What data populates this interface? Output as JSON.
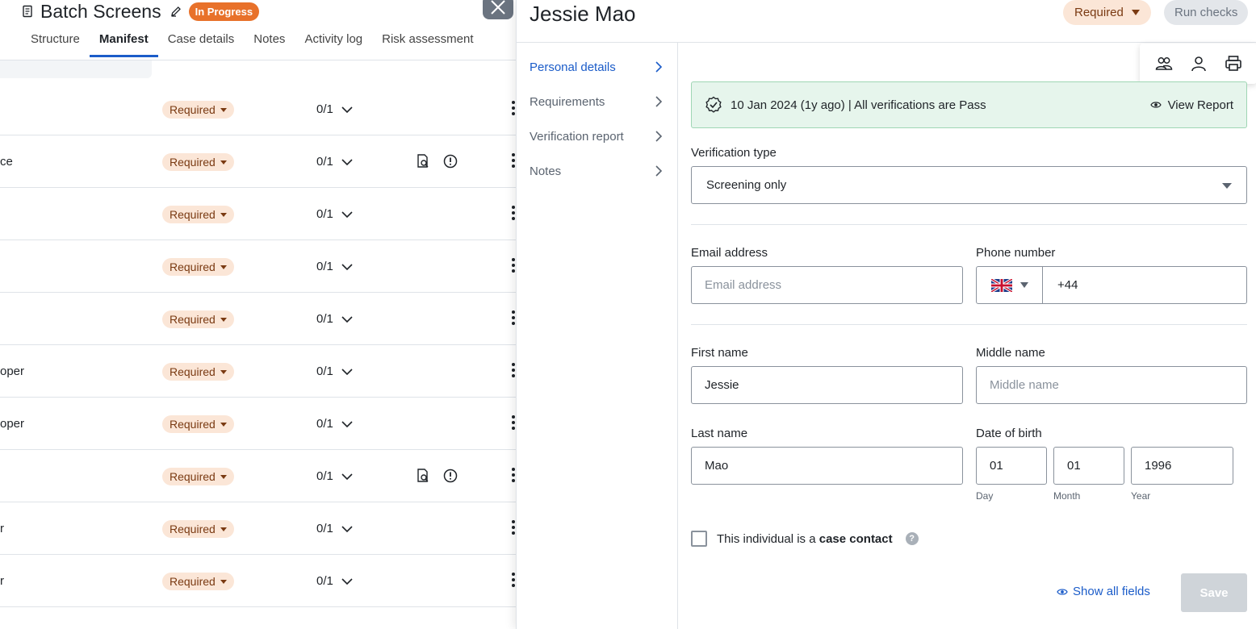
{
  "background": {
    "title": "Batch Screens",
    "status_badge": "In Progress",
    "tabs": [
      {
        "label": "Structure"
      },
      {
        "label": "Manifest"
      },
      {
        "label": "Case details"
      },
      {
        "label": "Notes"
      },
      {
        "label": "Activity log"
      },
      {
        "label": "Risk assessment"
      }
    ],
    "rows": [
      {
        "text": "",
        "status": "Required",
        "count": "0/1"
      },
      {
        "text": "ce",
        "status": "Required",
        "count": "0/1"
      },
      {
        "text": "",
        "status": "Required",
        "count": "0/1"
      },
      {
        "text": "",
        "status": "Required",
        "count": "0/1"
      },
      {
        "text": "",
        "status": "Required",
        "count": "0/1"
      },
      {
        "text": "oper",
        "status": "Required",
        "count": "0/1"
      },
      {
        "text": "oper",
        "status": "Required",
        "count": "0/1"
      },
      {
        "text": "",
        "status": "Required",
        "count": "0/1"
      },
      {
        "text": "r",
        "status": "Required",
        "count": "0/1"
      },
      {
        "text": "r",
        "status": "Required",
        "count": "0/1"
      }
    ]
  },
  "drawer": {
    "name": "Jessie Mao",
    "status_button": "Required",
    "run_checks": "Run checks",
    "nav": [
      {
        "label": "Personal details"
      },
      {
        "label": "Requirements"
      },
      {
        "label": "Verification report"
      },
      {
        "label": "Notes"
      }
    ],
    "toolbar_icons": [
      "people-icon",
      "person-icon",
      "printer-icon"
    ],
    "verification": {
      "summary": "10 Jan 2024 (1y ago)  |  All verifications are Pass",
      "view_report": "View Report"
    },
    "form": {
      "verification_type_label": "Verification type",
      "verification_type_value": "Screening only",
      "email_label": "Email address",
      "email_placeholder": "Email address",
      "phone_label": "Phone number",
      "phone_code": "+44",
      "first_name_label": "First name",
      "first_name_value": "Jessie",
      "middle_name_label": "Middle name",
      "middle_name_placeholder": "Middle name",
      "last_name_label": "Last name",
      "last_name_value": "Mao",
      "dob_label": "Date of birth",
      "dob_day": "01",
      "dob_month": "01",
      "dob_year": "1996",
      "dob_day_label": "Day",
      "dob_month_label": "Month",
      "dob_year_label": "Year",
      "case_contact_prefix": "This individual is a ",
      "case_contact_bold": "case contact",
      "help": "?",
      "show_all": "Show all fields",
      "save": "Save"
    }
  },
  "colors": {
    "accent": "#1b5cc9",
    "in_progress": "#e8712a",
    "required_bg": "#fbe6d7",
    "pass_bg": "#e6f5ec"
  }
}
